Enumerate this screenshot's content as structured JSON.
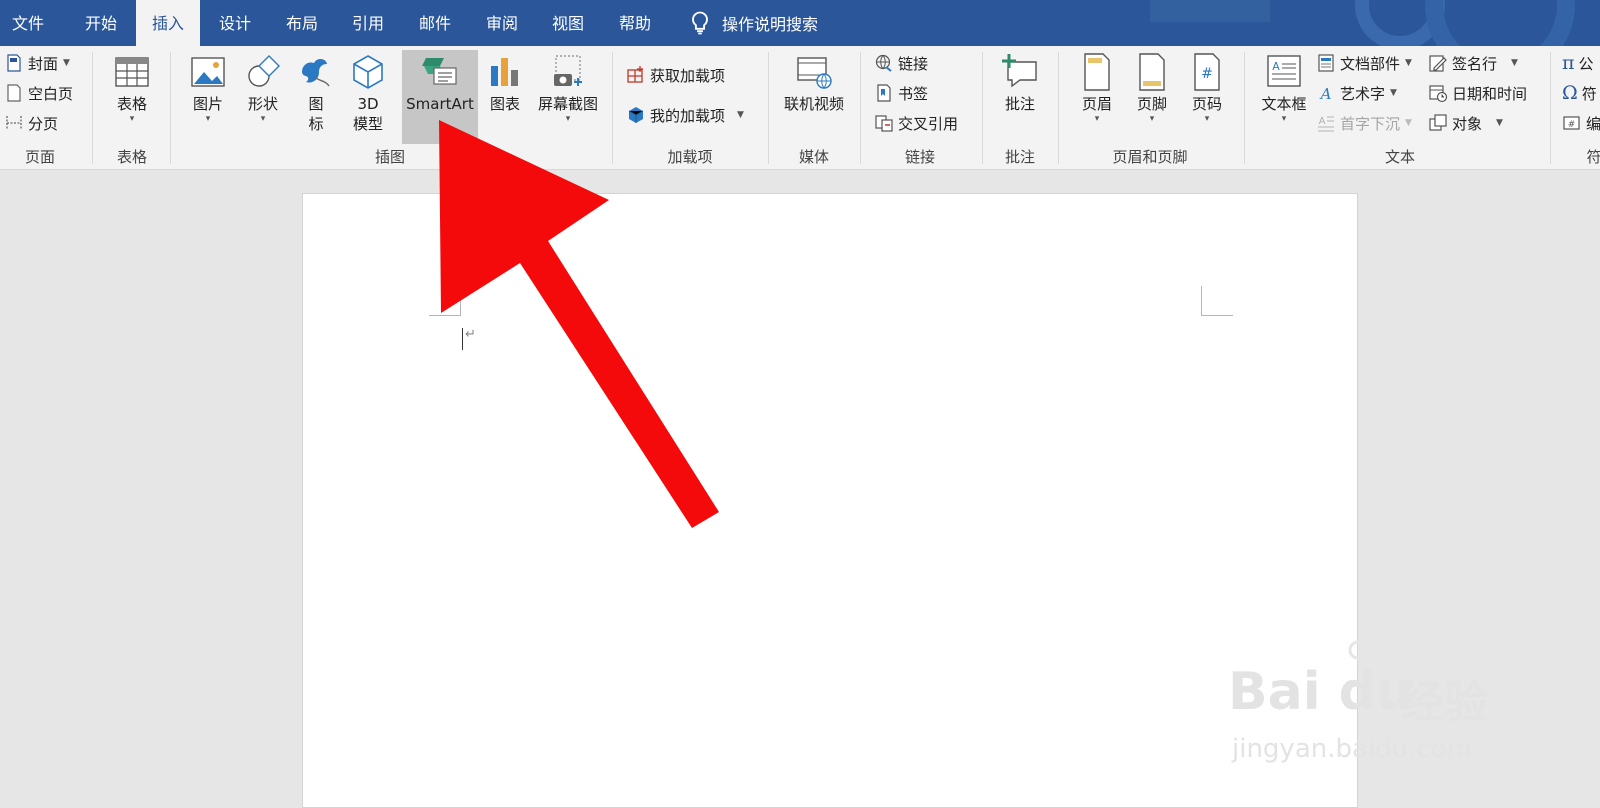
{
  "tabs": [
    "文件",
    "开始",
    "插入",
    "设计",
    "布局",
    "引用",
    "邮件",
    "审阅",
    "视图",
    "帮助"
  ],
  "active_tab": "插入",
  "tell_me": "操作说明搜索",
  "ribbon": {
    "pages": {
      "cover": "封面",
      "blank": "空白页",
      "break": "分页",
      "label": "页面"
    },
    "tables": {
      "table": "表格",
      "label": "表格"
    },
    "illustrations": {
      "picture": "图片",
      "shapes": "形状",
      "icons_1": "图",
      "icons_2": "标",
      "model_1": "3D",
      "model_2": "模型",
      "smartart": "SmartArt",
      "chart": "图表",
      "screenshot": "屏幕截图",
      "label": "插图"
    },
    "addins": {
      "get": "获取加载项",
      "mine": "我的加载项",
      "label": "加载项"
    },
    "media": {
      "video": "联机视频",
      "label": "媒体"
    },
    "links": {
      "link": "链接",
      "bookmark": "书签",
      "crossref": "交叉引用",
      "label": "链接"
    },
    "comments": {
      "comment": "批注",
      "label": "批注"
    },
    "header_footer": {
      "header": "页眉",
      "footer": "页脚",
      "page_number": "页码",
      "label": "页眉和页脚"
    },
    "text": {
      "textbox": "文本框",
      "quickparts": "文档部件",
      "wordart": "艺术字",
      "dropcap": "首字下沉",
      "signature": "签名行",
      "datetime": "日期和时间",
      "object": "对象",
      "label": "文本"
    },
    "symbols": {
      "equation": "公",
      "symbol": "符",
      "number": "编",
      "label": "符"
    }
  },
  "watermark": {
    "brand": "Bai  du",
    "cn": "经验",
    "url": "jingyan.baidu.com"
  },
  "colors": {
    "title_bar": "#2b579a",
    "ribbon": "#f3f3f3",
    "arrow": "#f40a0a",
    "hover": "#c6c6c6"
  }
}
